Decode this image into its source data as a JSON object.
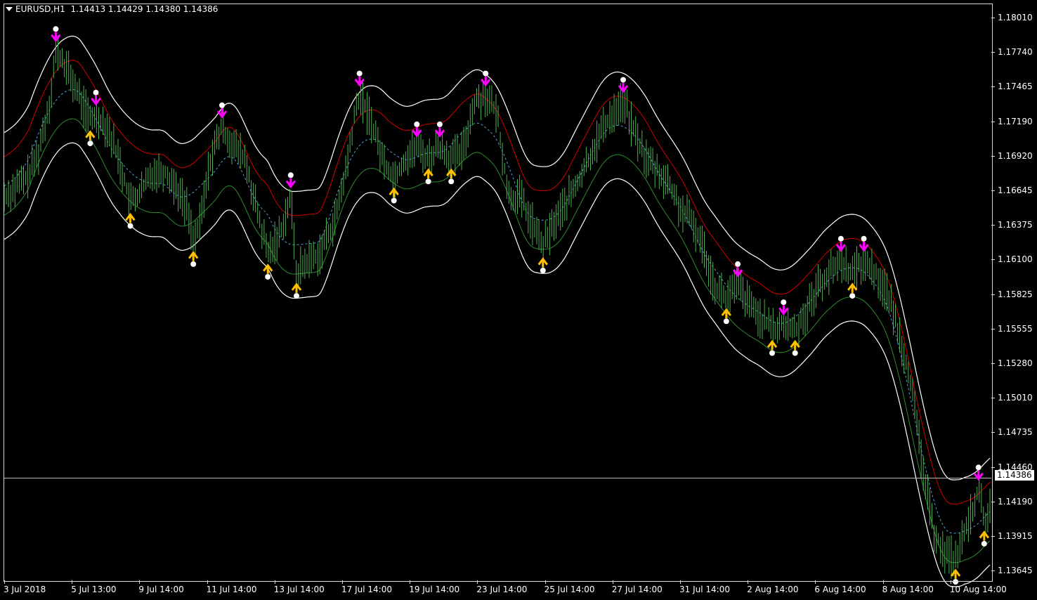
{
  "header": {
    "symbol_timeframe": "EURUSD,H1",
    "quote": "1.14413 1.14429 1.14380 1.14386"
  },
  "current_price_label": "1.14386",
  "colors": {
    "background": "#000000",
    "candle": "#4caf50",
    "upper_band": "#ffffff",
    "lower_band": "#ffffff",
    "red_line": "#d40000",
    "green_line": "#2e8b2e",
    "mid_dashed": "#4fa3d0",
    "down_arrow": "#ff00ff",
    "up_arrow": "#ffc000",
    "dot": "#ffffff"
  },
  "icons": {
    "down_signal": "magenta-down-arrow-icon",
    "up_signal": "yellow-up-arrow-icon",
    "marker": "white-dot-icon"
  },
  "chart_data": {
    "type": "line",
    "title": "EURUSD,H1",
    "y_ticks": [
      "1.18010",
      "1.17740",
      "1.17465",
      "1.17190",
      "1.16920",
      "1.16645",
      "1.16375",
      "1.16100",
      "1.15825",
      "1.15555",
      "1.15280",
      "1.15010",
      "1.14735",
      "1.14460",
      "1.14190",
      "1.13915",
      "1.13645"
    ],
    "x_ticks": [
      "3 Jul 2018",
      "5 Jul 13:00",
      "9 Jul 14:00",
      "11 Jul 14:00",
      "13 Jul 14:00",
      "17 Jul 14:00",
      "19 Jul 14:00",
      "23 Jul 14:00",
      "25 Jul 14:00",
      "27 Jul 14:00",
      "31 Jul 14:00",
      "2 Aug 14:00",
      "6 Aug 14:00",
      "8 Aug 14:00",
      "10 Aug 14:00"
    ],
    "ylim": [
      1.1355,
      1.1815
    ],
    "current_price": 1.14386,
    "price_path": [
      [
        0,
        1.166
      ],
      [
        4,
        1.1675
      ],
      [
        6,
        1.1695
      ],
      [
        8,
        1.1737
      ],
      [
        9,
        1.1775
      ],
      [
        11,
        1.176
      ],
      [
        13,
        1.174
      ],
      [
        15,
        1.172
      ],
      [
        16,
        1.1725
      ],
      [
        18,
        1.1715
      ],
      [
        20,
        1.169
      ],
      [
        22,
        1.1655
      ],
      [
        24,
        1.1665
      ],
      [
        26,
        1.168
      ],
      [
        28,
        1.168
      ],
      [
        30,
        1.1668
      ],
      [
        32,
        1.165
      ],
      [
        33,
        1.1625
      ],
      [
        34,
        1.1635
      ],
      [
        36,
        1.169
      ],
      [
        38,
        1.1715
      ],
      [
        40,
        1.17
      ],
      [
        42,
        1.169
      ],
      [
        44,
        1.165
      ],
      [
        46,
        1.1615
      ],
      [
        48,
        1.163
      ],
      [
        50,
        1.166
      ],
      [
        51,
        1.16
      ],
      [
        53,
        1.161
      ],
      [
        55,
        1.1615
      ],
      [
        56,
        1.1625
      ],
      [
        58,
        1.1645
      ],
      [
        60,
        1.169
      ],
      [
        61,
        1.172
      ],
      [
        62,
        1.174
      ],
      [
        64,
        1.172
      ],
      [
        66,
        1.169
      ],
      [
        68,
        1.1675
      ],
      [
        70,
        1.169
      ],
      [
        72,
        1.17
      ],
      [
        74,
        1.169
      ],
      [
        76,
        1.17
      ],
      [
        78,
        1.169
      ],
      [
        80,
        1.1695
      ],
      [
        82,
        1.1735
      ],
      [
        84,
        1.174
      ],
      [
        86,
        1.1725
      ],
      [
        88,
        1.166
      ],
      [
        90,
        1.166
      ],
      [
        92,
        1.164
      ],
      [
        94,
        1.162
      ],
      [
        96,
        1.164
      ],
      [
        98,
        1.1655
      ],
      [
        100,
        1.167
      ],
      [
        102,
        1.169
      ],
      [
        104,
        1.171
      ],
      [
        106,
        1.1725
      ],
      [
        108,
        1.1735
      ],
      [
        110,
        1.171
      ],
      [
        112,
        1.169
      ],
      [
        114,
        1.168
      ],
      [
        116,
        1.167
      ],
      [
        118,
        1.165
      ],
      [
        120,
        1.164
      ],
      [
        122,
        1.162
      ],
      [
        124,
        1.159
      ],
      [
        126,
        1.158
      ],
      [
        128,
        1.159
      ],
      [
        130,
        1.1575
      ],
      [
        132,
        1.1565
      ],
      [
        134,
        1.1555
      ],
      [
        136,
        1.156
      ],
      [
        138,
        1.1555
      ],
      [
        140,
        1.157
      ],
      [
        142,
        1.159
      ],
      [
        144,
        1.16
      ],
      [
        146,
        1.161
      ],
      [
        148,
        1.16
      ],
      [
        150,
        1.161
      ],
      [
        152,
        1.16
      ],
      [
        154,
        1.1585
      ],
      [
        156,
        1.1555
      ],
      [
        158,
        1.152
      ],
      [
        160,
        1.1455
      ],
      [
        162,
        1.14
      ],
      [
        164,
        1.138
      ],
      [
        166,
        1.1375
      ],
      [
        168,
        1.14
      ],
      [
        170,
        1.143
      ],
      [
        171,
        1.1405
      ],
      [
        172,
        1.1415
      ]
    ]
  }
}
